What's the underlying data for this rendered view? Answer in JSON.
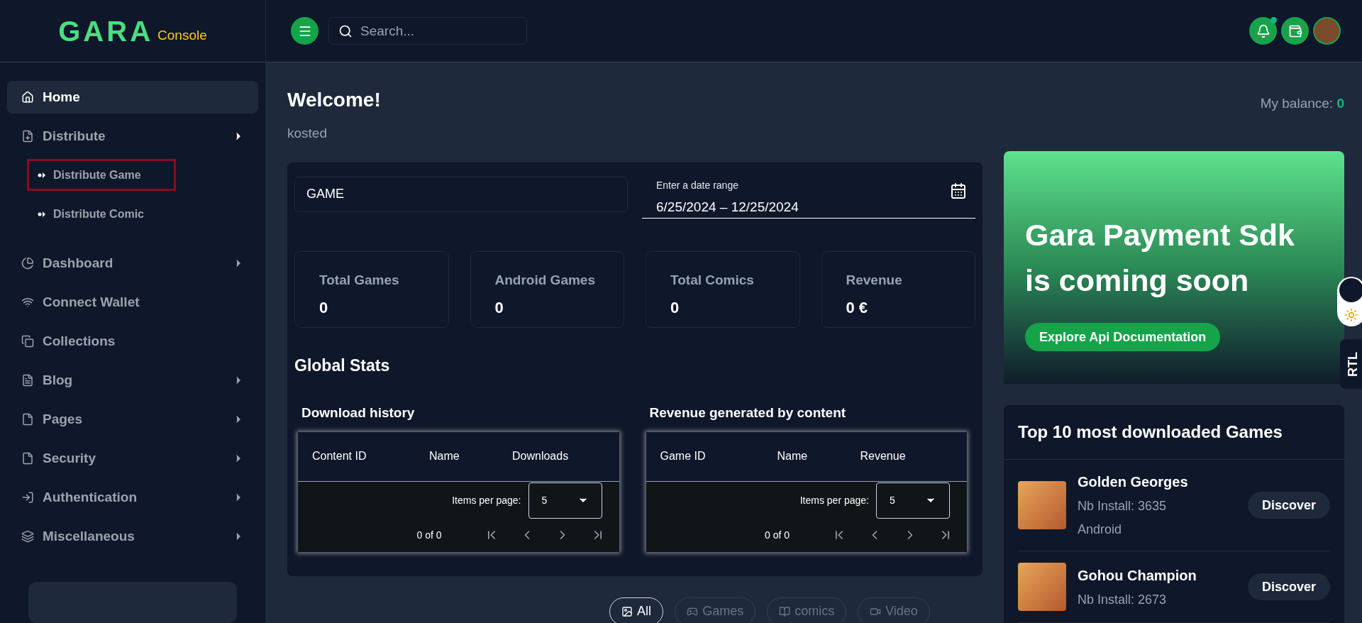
{
  "logo": {
    "text": "GARA",
    "suffix": "Console"
  },
  "sidebar": {
    "items": [
      {
        "label": "Home",
        "kind": "link",
        "selected": true
      },
      {
        "label": "Distribute",
        "kind": "submenu",
        "selected": false,
        "expanded": true,
        "children": [
          {
            "label": "Distribute Game",
            "selected": true
          },
          {
            "label": "Distribute Comic",
            "selected": false
          }
        ]
      },
      {
        "label": "Dashboard",
        "kind": "submenu",
        "selected": false,
        "expanded": false
      },
      {
        "label": "Connect Wallet",
        "kind": "link",
        "selected": false
      },
      {
        "label": "Collections",
        "kind": "link",
        "selected": false
      },
      {
        "label": "Blog",
        "kind": "submenu",
        "selected": false,
        "expanded": false
      },
      {
        "label": "Pages",
        "kind": "submenu",
        "selected": false,
        "expanded": false
      },
      {
        "label": "Security",
        "kind": "submenu",
        "selected": false,
        "expanded": false
      },
      {
        "label": "Authentication",
        "kind": "submenu",
        "selected": false,
        "expanded": false
      },
      {
        "label": "Miscellaneous",
        "kind": "submenu",
        "selected": false,
        "expanded": false
      }
    ]
  },
  "header": {
    "search": {
      "placeholder": "Search..."
    },
    "notification_dot": true
  },
  "welcome": {
    "title": "Welcome!",
    "user": "kosted",
    "balance_label": "My balance:",
    "balance_value": "0"
  },
  "filters": {
    "type_value": "GAME",
    "date_label": "Enter a date range",
    "date_value": "6/25/2024 – 12/25/2024"
  },
  "stats": [
    {
      "label": "Total Games",
      "value": "0"
    },
    {
      "label": "Android Games",
      "value": "0"
    },
    {
      "label": "Total Comics",
      "value": "0"
    },
    {
      "label": "Revenue",
      "value": "0 €"
    }
  ],
  "global_stats_title": "Global Stats",
  "tables": [
    {
      "title": "Download history",
      "columns": [
        "Content ID",
        "Name",
        "Downloads"
      ],
      "items_per_page_label": "Items per page:",
      "items_per_page": "5",
      "range": "0 of 0"
    },
    {
      "title": "Revenue generated by content",
      "columns": [
        "Game ID",
        "Name",
        "Revenue"
      ],
      "items_per_page_label": "Items per page:",
      "items_per_page": "5",
      "range": "0 of 0"
    }
  ],
  "filter_tabs": [
    {
      "label": "All",
      "selected": true
    },
    {
      "label": "Games",
      "selected": false
    },
    {
      "label": "comics",
      "selected": false
    },
    {
      "label": "Video",
      "selected": false
    }
  ],
  "promo": {
    "title": "Gara Payment Sdk is coming soon",
    "button": "Explore Api Documentation"
  },
  "side_toggles": {
    "rtl": "RTL",
    "dark_mode": true
  },
  "top_games": {
    "title": "Top 10 most downloaded Games",
    "items": [
      {
        "name": "Golden Georges",
        "installs": "Nb Install: 3635",
        "platform": "Android",
        "button": "Discover"
      },
      {
        "name": "Gohou Champion",
        "installs": "Nb Install: 2673",
        "button": "Discover"
      }
    ]
  }
}
